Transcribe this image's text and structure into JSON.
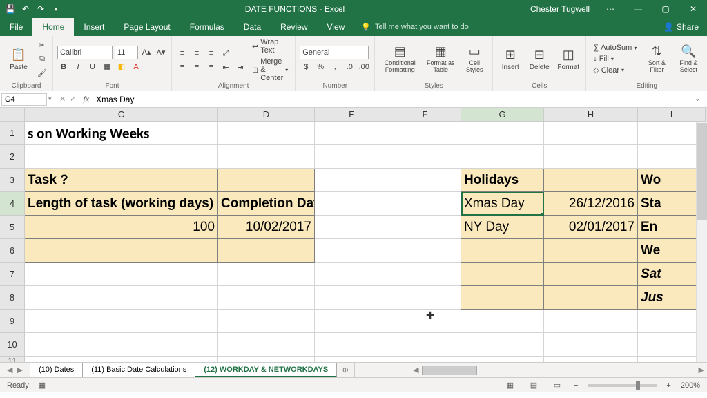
{
  "window": {
    "title": "DATE FUNCTIONS - Excel",
    "user": "Chester Tugwell",
    "share": "Share"
  },
  "qat": {
    "save": "💾",
    "undo": "↶",
    "redo": "↷"
  },
  "tabs": {
    "file": "File",
    "home": "Home",
    "insert": "Insert",
    "page_layout": "Page Layout",
    "formulas": "Formulas",
    "data": "Data",
    "review": "Review",
    "view": "View",
    "tellme": "Tell me what you want to do"
  },
  "ribbon": {
    "clipboard": {
      "label": "Clipboard",
      "paste": "Paste"
    },
    "font": {
      "label": "Font",
      "name": "Calibri",
      "size": "11",
      "bold": "B",
      "italic": "I",
      "underline": "U"
    },
    "alignment": {
      "label": "Alignment",
      "wrap": "Wrap Text",
      "merge": "Merge & Center"
    },
    "number": {
      "label": "Number",
      "format": "General"
    },
    "styles": {
      "label": "Styles",
      "cond": "Conditional Formatting",
      "table": "Format as Table",
      "cell": "Cell Styles"
    },
    "cells": {
      "label": "Cells",
      "insert": "Insert",
      "delete": "Delete",
      "format": "Format"
    },
    "editing": {
      "label": "Editing",
      "autosum": "AutoSum",
      "fill": "Fill",
      "clear": "Clear",
      "sort": "Sort & Filter",
      "find": "Find & Select"
    }
  },
  "formula_bar": {
    "name_box": "G4",
    "formula": "Xmas Day"
  },
  "columns": [
    "C",
    "D",
    "E",
    "F",
    "G",
    "H",
    "I"
  ],
  "rows": [
    "1",
    "2",
    "3",
    "4",
    "5",
    "6",
    "7",
    "8",
    "9",
    "10",
    "11"
  ],
  "cells": {
    "C1": "s on Working Weeks",
    "C3": "Task ?",
    "C4": "Length of task (working days)",
    "D4": "Completion Date",
    "C5": "100",
    "D5": "10/02/2017",
    "G3": "Holidays",
    "G4": "Xmas Day",
    "H4": "26/12/2016",
    "G5": "NY Day",
    "H5": "02/01/2017",
    "I3": "Wo",
    "I4": "Sta",
    "I5": "En",
    "I6": "We",
    "I7": "Sat",
    "I8": "Jus"
  },
  "ws_tabs": {
    "t1": "(10) Dates",
    "t2": "(11) Basic Date Calculations",
    "t3": "(12) WORKDAY & NETWORKDAYS"
  },
  "status": {
    "ready": "Ready",
    "zoom": "200%"
  }
}
